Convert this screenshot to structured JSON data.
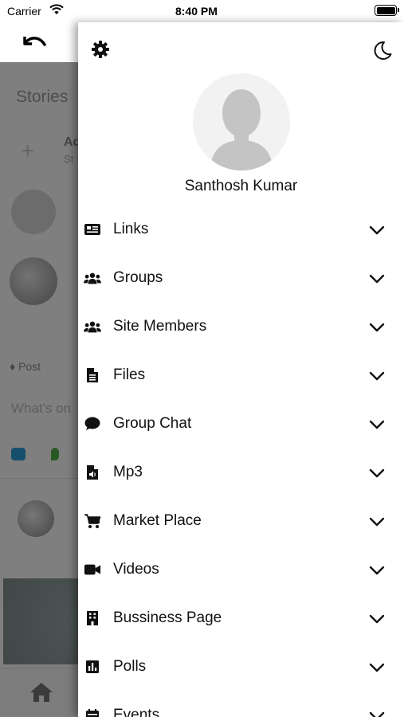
{
  "status_bar": {
    "carrier": "Carrier",
    "time": "8:40 PM"
  },
  "background": {
    "stories_title": "Stories",
    "add_story_title": "Ad",
    "add_story_sub": "St",
    "post_label": "Post",
    "composer_placeholder": "What's on"
  },
  "drawer": {
    "settings_icon": "gear-icon",
    "theme_icon": "moon-icon",
    "profile_name": "Santhosh Kumar",
    "menu": [
      {
        "label": "Links",
        "icon": "news-icon"
      },
      {
        "label": "Groups",
        "icon": "users-icon"
      },
      {
        "label": "Site Members",
        "icon": "users-icon"
      },
      {
        "label": "Files",
        "icon": "file-icon"
      },
      {
        "label": "Group Chat",
        "icon": "chat-bubble-icon"
      },
      {
        "label": "Mp3",
        "icon": "audio-file-icon"
      },
      {
        "label": "Market Place",
        "icon": "cart-icon"
      },
      {
        "label": "Videos",
        "icon": "video-camera-icon"
      },
      {
        "label": "Bussiness Page",
        "icon": "building-icon"
      },
      {
        "label": "Polls",
        "icon": "poll-icon"
      },
      {
        "label": "Events",
        "icon": "calendar-icon"
      }
    ]
  },
  "colors": {
    "text": "#111111",
    "icon": "#111111",
    "dim_overlay": "rgba(0,0,0,0.5)"
  }
}
